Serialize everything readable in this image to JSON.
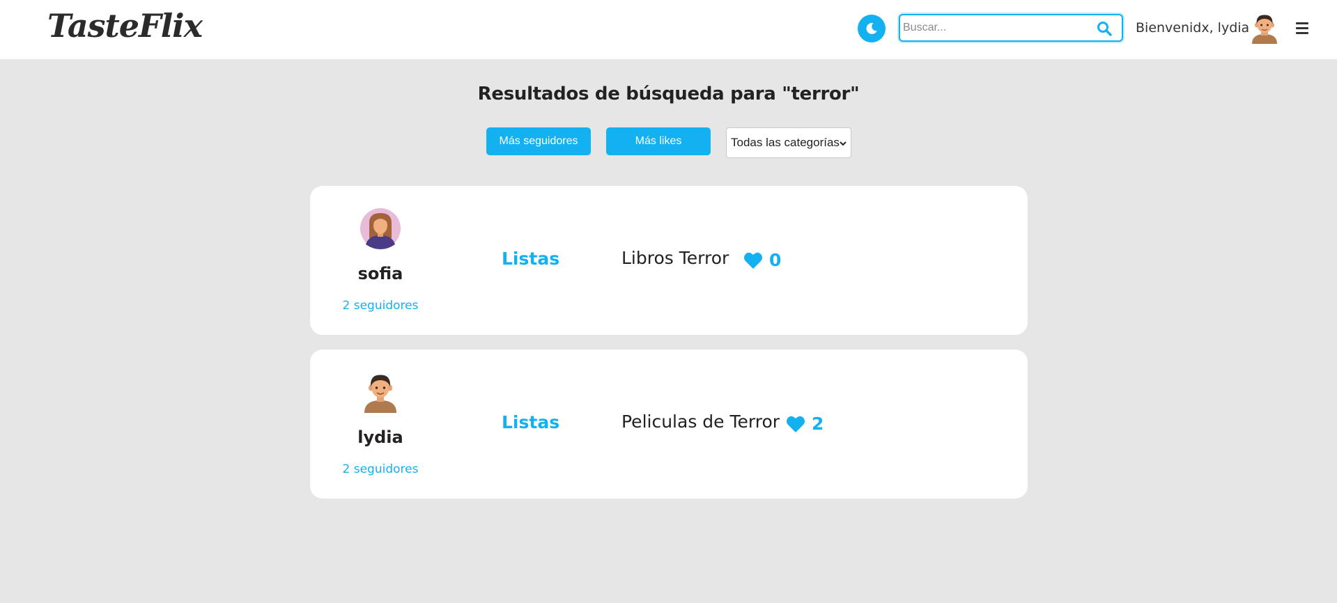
{
  "header": {
    "logo": "TasteFlix",
    "search_placeholder": "Buscar...",
    "welcome": "Bienvenidx, lydia"
  },
  "page": {
    "title": "Resultados de búsqueda para \"terror\""
  },
  "filters": {
    "followers_label": "Más seguidores",
    "likes_label": "Más likes",
    "category_selected": "Todas las categorías"
  },
  "results": [
    {
      "username": "sofia",
      "followers": "2 seguidores",
      "lists_label": "Listas",
      "list_name": "Libros Terror",
      "likes": "0"
    },
    {
      "username": "lydia",
      "followers": "2 seguidores",
      "lists_label": "Listas",
      "list_name": "Peliculas de Terror",
      "likes": "2"
    }
  ],
  "colors": {
    "accent": "#13b1f0",
    "background": "#e6e6e6",
    "card": "#ffffff"
  },
  "icons": [
    "moon-icon",
    "search-icon",
    "menu-icon",
    "heart-icon",
    "chevron-down-icon",
    "avatar-female",
    "avatar-male"
  ]
}
